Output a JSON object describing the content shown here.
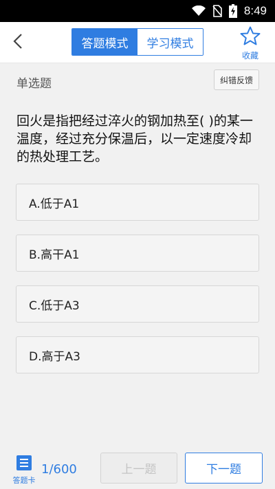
{
  "status_bar": {
    "time": "8:49",
    "icons": [
      "wifi-icon",
      "no-sim-icon",
      "battery-charging-icon"
    ]
  },
  "header": {
    "modes": [
      {
        "label": "答题模式",
        "active": true
      },
      {
        "label": "学习模式",
        "active": false
      }
    ],
    "favorite_label": "收藏",
    "icons": {
      "back": "back-arrow-icon",
      "favorite": "star-outline-icon"
    }
  },
  "question": {
    "type": "单选题",
    "feedback_label": "纠错反馈",
    "text": "回火是指把经过淬火的钢加热至( )的某一温度，经过充分保温后，以一定速度冷却的热处理工艺。",
    "options": [
      {
        "label": "A.低于A1"
      },
      {
        "label": "B.高干A1"
      },
      {
        "label": "C.低于A3"
      },
      {
        "label": "D.高于A3"
      }
    ]
  },
  "footer": {
    "card_label": "答题卡",
    "progress": "1/600",
    "current": 1,
    "total": 600,
    "prev_label": "上一题",
    "next_label": "下一题",
    "prev_enabled": false
  },
  "colors": {
    "accent": "#2f7de1",
    "background": "#f1f1f1"
  }
}
